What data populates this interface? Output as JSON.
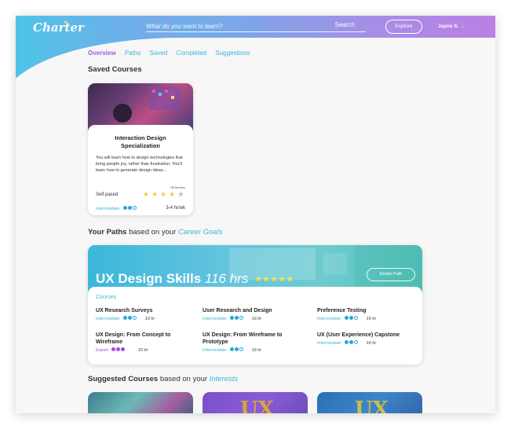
{
  "header": {
    "logo": "Charter",
    "search_placeholder": "What do you want to learn?",
    "search_button": "Search",
    "explore_button": "Explore",
    "user_name": "Jayne S."
  },
  "tabs": [
    {
      "label": "Overview",
      "active": true
    },
    {
      "label": "Paths",
      "active": false
    },
    {
      "label": "Saved",
      "active": false
    },
    {
      "label": "Completed",
      "active": false
    },
    {
      "label": "Suggestions",
      "active": false
    }
  ],
  "saved_section": {
    "title": "Saved Courses"
  },
  "saved_course": {
    "title": "Interaction Design Specialization",
    "description": "You will learn how to design technologies that bring people joy, rather than frustration. You'll learn how to generate design ideas...",
    "reviews": "738 Reviews",
    "pace": "Self paced",
    "rating": 4,
    "rating_max": 5,
    "level": "Intermediate",
    "level_dots": 2,
    "hours": "3-4 hr/wk"
  },
  "paths_section": {
    "title_bold": "Your Paths",
    "title_normal": " based on your ",
    "title_accent": "Career Goals"
  },
  "path": {
    "title": "UX Design Skills",
    "hours": "116 hrs",
    "rating": 5,
    "delete_button": "Delete Path",
    "courses_label": "Courses",
    "courses": [
      {
        "name": "UX Research Surveys",
        "level": "Intermediate",
        "dots": 2,
        "hours": "10 hr"
      },
      {
        "name": "User Research and Design",
        "level": "Intermediate",
        "dots": 2,
        "hours": "16 hr"
      },
      {
        "name": "Preference Testing",
        "level": "Intermediate",
        "dots": 2,
        "hours": "16 hr"
      },
      {
        "name": "UX Design: From Concept to Wireframe",
        "level": "Expert",
        "dots": 3,
        "hours": "10 hr"
      },
      {
        "name": "UX Design: From Wireframe to Prototype",
        "level": "Intermediate",
        "dots": 2,
        "hours": "16 hr"
      },
      {
        "name": "UX (User Experience) Capstone",
        "level": "Intermediate",
        "dots": 2,
        "hours": "16 hr"
      }
    ]
  },
  "suggested_section": {
    "title_bold": "Suggested Courses",
    "title_normal": " based on your ",
    "title_accent": "Interests"
  },
  "colors": {
    "accent_blue": "#3ab5d9",
    "accent_purple": "#9b5fe0",
    "star_yellow": "#f5c542"
  }
}
